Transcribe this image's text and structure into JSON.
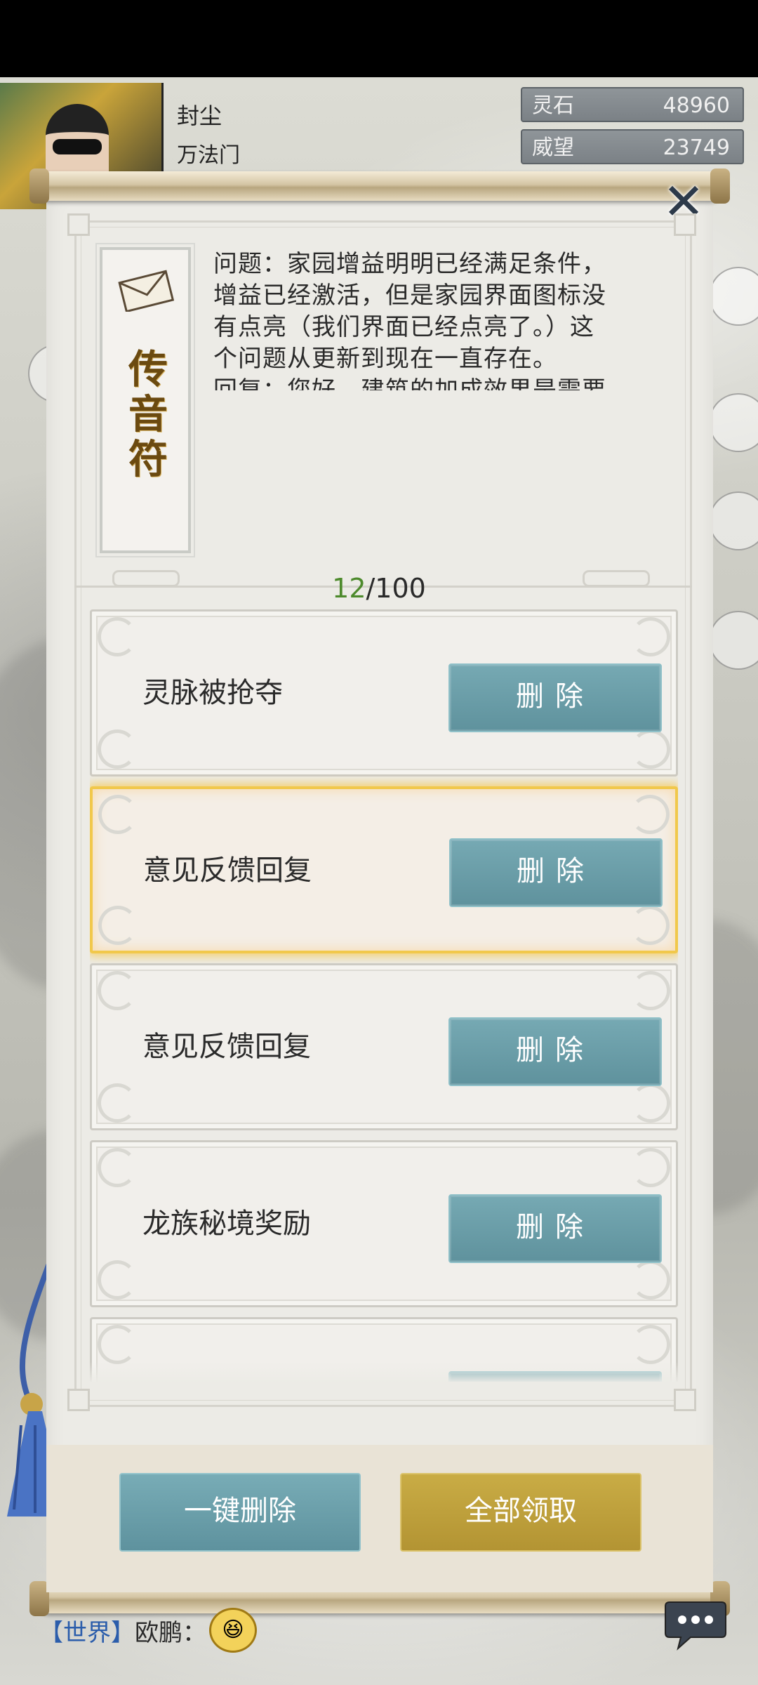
{
  "header": {
    "player_name": "封尘",
    "sect": "万法门",
    "resources": [
      {
        "label": "灵石",
        "value": "48960"
      },
      {
        "label": "威望",
        "value": "23749"
      }
    ]
  },
  "panel": {
    "close_symbol": "✕",
    "tag_title": "传音符",
    "message_lines": [
      "问题：家园增益明明已经满足条件，",
      "增益已经激活，但是家园界面图标没",
      "有点亮（我们界面已经点亮了。）这",
      "个问题从更新到现在一直存在。",
      "回复：您好，建筑的加成效果是需要"
    ],
    "counter": {
      "current": "12",
      "total": "/100"
    },
    "mails": [
      {
        "title": "灵脉被抢夺",
        "delete_label": "删除",
        "selected": false
      },
      {
        "title": "意见反馈回复",
        "delete_label": "删除",
        "selected": true
      },
      {
        "title": "意见反馈回复",
        "delete_label": "删除",
        "selected": false
      },
      {
        "title": "龙族秘境奖励",
        "delete_label": "删除",
        "selected": false
      },
      {
        "title": "",
        "delete_label": "",
        "selected": false
      }
    ],
    "delete_all_label": "一键删除",
    "claim_all_label": "全部领取"
  },
  "chat": {
    "channel": "【世界】",
    "sender": "欧鹏：",
    "emoji": "😆"
  }
}
